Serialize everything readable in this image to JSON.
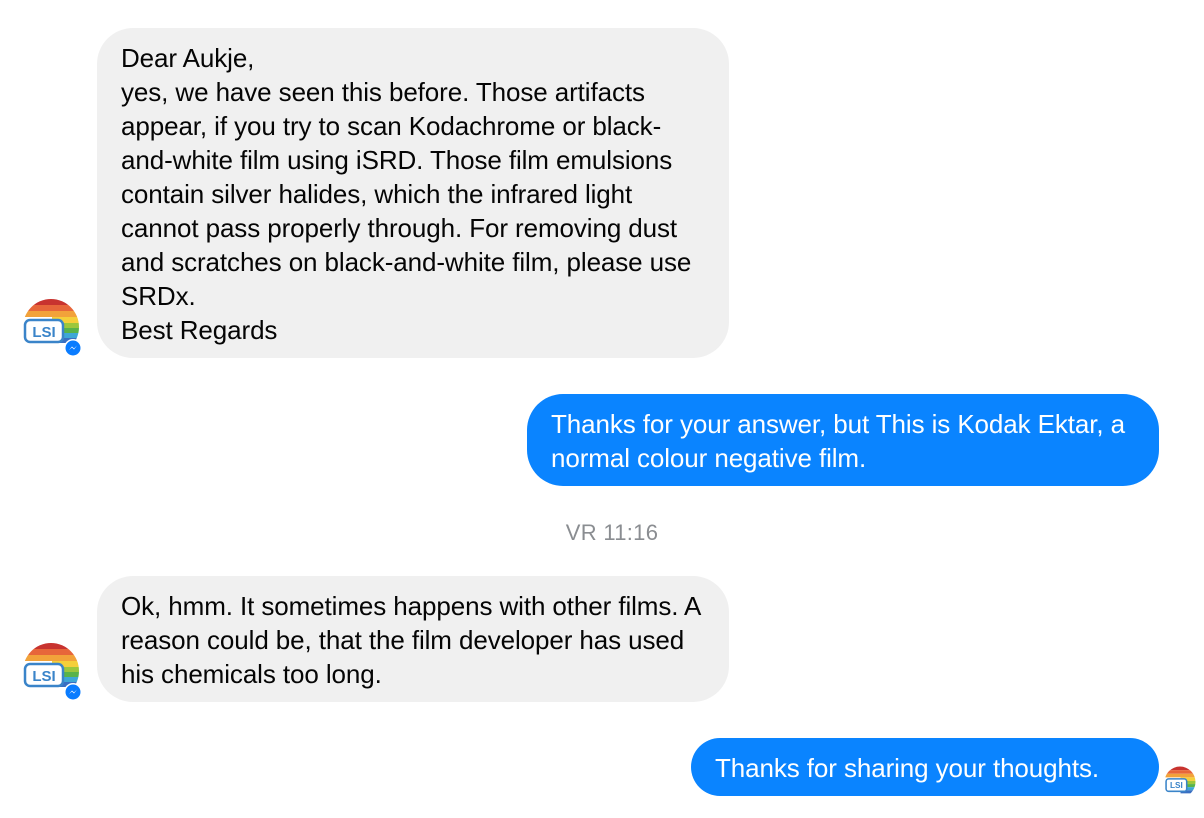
{
  "conversation": {
    "messages": [
      {
        "sender": "LSI",
        "text": "Dear Aukje,\nyes, we have seen this before. Those artifacts appear, if you try to scan Kodachrome or black-and-white film using iSRD. Those film emulsions contain silver halides, which the infrared light cannot pass properly through. For removing dust and scratches on black-and-white film, please use SRDx.\nBest Regards"
      },
      {
        "sender": "me",
        "text": "Thanks for your answer, but This is Kodak Ektar, a normal colour negative film."
      },
      {
        "sender": "LSI",
        "text": "Ok, hmm. It sometimes happens with other films. A reason could be, that the film developer has used his chemicals too long."
      },
      {
        "sender": "me",
        "text": "Thanks for sharing your thoughts."
      }
    ],
    "timestamp": "VR 11:16",
    "avatar_label": "LSI"
  },
  "colors": {
    "incoming_bubble": "#f0f0f0",
    "outgoing_bubble": "#0a84ff",
    "timestamp_text": "#8a8d91",
    "messenger_badge": "#0a7cff"
  },
  "icons": {
    "avatar": "lsi-logo-icon",
    "badge": "messenger-badge-icon"
  }
}
